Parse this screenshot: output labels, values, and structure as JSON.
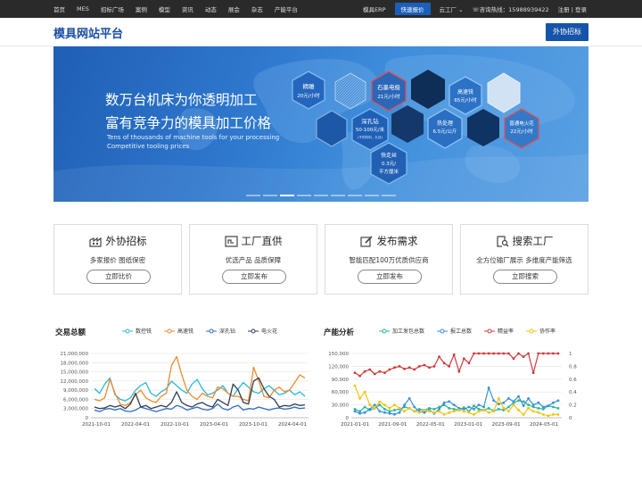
{
  "topnav": {
    "items": [
      "首页",
      "MES",
      "招标广场",
      "案例",
      "模型",
      "资讯",
      "动态",
      "展会",
      "杂志",
      "产能平台"
    ],
    "erp": "模具ERP",
    "quick_quote": "快速报价",
    "factory": "云工厂",
    "hotline": "咨询热线：15988939422",
    "auth": "注册 | 登录"
  },
  "header": {
    "logo": "模具网站平台",
    "outsource_button": "外协招标"
  },
  "banner": {
    "headline_1": "数万台机床为你透明加工",
    "headline_2": "富有竞争力的模具加工价格",
    "en_1": "Tens of thousands of machine tools for your processing",
    "en_2": "Competitive tooling prices",
    "hexes": [
      {
        "l1": "精雕",
        "l2": "20元/小时",
        "l3": ""
      },
      {
        "l1": "石墨电极",
        "l2": "21元/小时",
        "l3": ""
      },
      {
        "l1": "高速铣",
        "l2": "65元/小时",
        "l3": ""
      },
      {
        "l1": "深孔钻",
        "l2": "50-100元/米",
        "l3": "(不同材料，孔径)"
      },
      {
        "l1": "热处理",
        "l2": "6.5元/公斤",
        "l3": ""
      },
      {
        "l1": "普通电火花",
        "l2": "22元/小时",
        "l3": ""
      },
      {
        "l1": "快走丝",
        "l2": "0.3元/",
        "l3": "平方厘米"
      }
    ],
    "slide_count": 9,
    "active_slide": 3
  },
  "cards": [
    {
      "title": "外协招标",
      "sub": "多家报价 图纸保密",
      "button": "立即比价",
      "icon": "factory-icon"
    },
    {
      "title": "工厂直供",
      "sub": "优选产品 品质保障",
      "button": "立即发布",
      "icon": "board-icon"
    },
    {
      "title": "发布需求",
      "sub": "智能匹配100万优质供应商",
      "button": "立即发布",
      "icon": "edit-icon"
    },
    {
      "title": "搜索工厂",
      "sub": "全方位输厂展示 多维度产能筛选",
      "button": "立即搜索",
      "icon": "search-doc-icon"
    }
  ],
  "colors": {
    "accent": "#1554a8",
    "s1": "#2bb7d3",
    "s2": "#f08a2c",
    "s3": "#2d6cc0",
    "s4": "#2f3e56",
    "r1": "#25b79b",
    "r2": "#3b8fd8",
    "r3": "#cc3b3b",
    "r4": "#f2c30f"
  },
  "chart_data": [
    {
      "type": "line",
      "title": "交易总额",
      "series": [
        {
          "name": "数控铣",
          "values": [
            9500000,
            8000000,
            11000000,
            13000000,
            7500000,
            6000000,
            5500000,
            6500000,
            9000000,
            10500000,
            11500000,
            8000000,
            7000000,
            8500000,
            9500000,
            12000000,
            10500000,
            9000000,
            8000000,
            11000000,
            12500000,
            9500000,
            7500000,
            8000000,
            9000000,
            10500000,
            8000000,
            7000000,
            9500000,
            11500000,
            10000000,
            8500000,
            8000000,
            9500000,
            10500000,
            9000000,
            7500000,
            8000000,
            9000000,
            7500000,
            8500000,
            7000000
          ]
        },
        {
          "name": "高速铣",
          "values": [
            6000000,
            5500000,
            6500000,
            12500000,
            8000000,
            4500000,
            4000000,
            5000000,
            7500000,
            9000000,
            6500000,
            5500000,
            5000000,
            7000000,
            8000000,
            17000000,
            20000000,
            14000000,
            9000000,
            7000000,
            6000000,
            8000000,
            7000000,
            6500000,
            10000000,
            9500000,
            8000000,
            7000000,
            7000000,
            6000000,
            5500000,
            16500000,
            12000000,
            7000000,
            6500000,
            9000000,
            10000000,
            8500000,
            9000000,
            11500000,
            14000000,
            13000000
          ]
        },
        {
          "name": "深孔钻",
          "values": [
            2500000,
            2000000,
            2800000,
            3000000,
            2500000,
            3000000,
            2200000,
            2000000,
            2500000,
            3500000,
            3000000,
            2500000,
            2000000,
            2500000,
            3000000,
            2800000,
            4000000,
            3500000,
            2500000,
            3000000,
            3500000,
            2800000,
            2500000,
            3000000,
            4500000,
            3000000,
            2500000,
            3500000,
            4000000,
            2500000,
            3000000,
            2800000,
            3500000,
            3000000,
            2500000,
            3000000,
            3200000,
            2800000,
            3000000,
            3500000,
            3000000,
            3200000
          ]
        },
        {
          "name": "电火花",
          "values": [
            3500000,
            3000000,
            3200000,
            4000000,
            3500000,
            4000000,
            3000000,
            4500000,
            8000000,
            3500000,
            4000000,
            3000000,
            3500000,
            4000000,
            3500000,
            5000000,
            8500000,
            5000000,
            4000000,
            3500000,
            4500000,
            5000000,
            4000000,
            3500000,
            6000000,
            5000000,
            4000000,
            11000000,
            9000000,
            5000000,
            4500000,
            12000000,
            13000000,
            9500000,
            7000000,
            6000000,
            3500000,
            4000000,
            3800000,
            4500000,
            4000000,
            4200000
          ]
        }
      ],
      "xticks": [
        "2021-10-01",
        "2022-04-01",
        "2022-10-01",
        "2023-04-01",
        "2023-10-01",
        "2024-04-01"
      ],
      "yticks": [
        0,
        3000000,
        6000000,
        9000000,
        12000000,
        15000000,
        18000000,
        21000000
      ],
      "ytick_labels": [
        "0",
        "3,000,000",
        "6,000,000",
        "9,000,000",
        "12,000,000",
        "15,000,000",
        "18,000,000",
        "21,000,000"
      ],
      "ylim": [
        0,
        21000000
      ]
    },
    {
      "type": "line",
      "title": "产能分析",
      "series": [
        {
          "name": "加工发包总数",
          "axis": "left",
          "values": [
            20000,
            15000,
            25000,
            18000,
            22000,
            30000,
            20000,
            15000,
            18000,
            20000,
            25000,
            22000,
            15000,
            20000,
            18000,
            22000,
            20000,
            25000,
            30000,
            22000,
            20000,
            18000,
            24000,
            15000,
            28000,
            20000,
            18000,
            22000,
            16000,
            20000,
            18000,
            25000,
            35000,
            40000,
            38000,
            30000,
            25000,
            22000,
            20000,
            28000,
            25000,
            22000
          ]
        },
        {
          "name": "报工总数",
          "axis": "left",
          "values": [
            15000,
            10000,
            12000,
            20000,
            30000,
            15000,
            12000,
            10000,
            8000,
            12000,
            30000,
            45000,
            25000,
            15000,
            12000,
            18000,
            10000,
            20000,
            35000,
            38000,
            30000,
            22000,
            20000,
            25000,
            20000,
            30000,
            25000,
            70000,
            40000,
            32000,
            35000,
            45000,
            38000,
            50000,
            28000,
            45000,
            30000,
            35000,
            25000,
            28000,
            35000,
            40000
          ]
        },
        {
          "name": "精益率",
          "axis": "right",
          "values": [
            0.7,
            0.65,
            0.72,
            0.75,
            0.68,
            0.72,
            0.7,
            0.75,
            0.78,
            0.8,
            0.76,
            0.78,
            0.75,
            0.8,
            0.82,
            0.78,
            0.8,
            0.95,
            0.85,
            0.8,
            0.98,
            0.72,
            0.92,
            0.85,
            1.0,
            1.0,
            1.0,
            1.0,
            1.0,
            1.0,
            1.0,
            1.0,
            0.92,
            1.0,
            0.95,
            1.0,
            0.7,
            1.0,
            1.0,
            1.0,
            1.0,
            1.0
          ]
        },
        {
          "name": "协作率",
          "axis": "right",
          "values": [
            0.5,
            0.3,
            0.4,
            0.2,
            0.15,
            0.25,
            0.2,
            0.15,
            0.2,
            0.15,
            0.1,
            0.15,
            0.1,
            0.08,
            0.12,
            0.1,
            0.08,
            0.1,
            0.05,
            0.08,
            0.1,
            0.12,
            0.1,
            0.08,
            0.05,
            0.1,
            0.12,
            0.08,
            0.1,
            0.3,
            0.15,
            0.1,
            0.2,
            0.12,
            0.05,
            0.15,
            0.1,
            0.08,
            0.05,
            0.03,
            0.05,
            0.05
          ]
        }
      ],
      "xticks": [
        "2021-01-01",
        "2021-09-01",
        "2022-05-01",
        "2023-01-01",
        "2023-09-01",
        "2024-05-01"
      ],
      "yticks_left": [
        0,
        30000,
        60000,
        90000,
        120000,
        150000
      ],
      "ytick_labels_left": [
        "0",
        "30,000",
        "60,000",
        "90,000",
        "120,000",
        "150,000"
      ],
      "yticks_right": [
        0,
        0.2,
        0.4,
        0.6,
        0.8,
        1
      ],
      "ylim_left": [
        0,
        150000
      ],
      "ylim_right": [
        0,
        1
      ]
    }
  ]
}
